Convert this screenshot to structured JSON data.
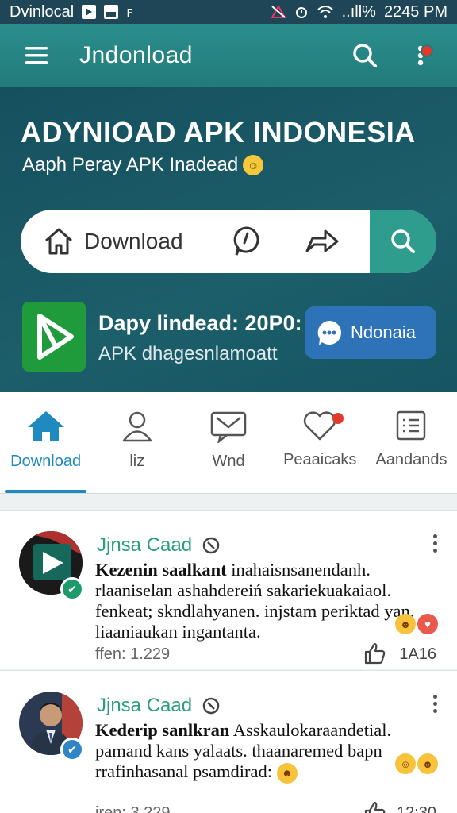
{
  "status_bar": {
    "carrier": "Dvinlocal",
    "time": "2245 PM",
    "signal": "..ıll%"
  },
  "app_bar": {
    "title": "Jndonload"
  },
  "hero": {
    "title": "ADYNIOAD APK INDONESIA",
    "subtitle": "Aaph Peray APK Inadead",
    "search": {
      "label": "Download"
    },
    "promo": {
      "title": "Dapy lindead: 20P0:",
      "subtitle": "APK dhagesnlamoatt",
      "button_label": "Ndonaia"
    }
  },
  "tabs": [
    {
      "label": "Download",
      "icon": "home-icon",
      "active": true
    },
    {
      "label": "liz",
      "icon": "person-icon",
      "active": false
    },
    {
      "label": "Wnd",
      "icon": "chat-icon",
      "active": false
    },
    {
      "label": "Peaaicaks",
      "icon": "heart-icon",
      "active": false
    },
    {
      "label": "Aandands",
      "icon": "list-icon",
      "active": false
    }
  ],
  "feed": [
    {
      "name": "Jjnsa Caad",
      "text_bold": "Kezenin saalkant",
      "text": " inahaisnsanendanh. rlaaniselan ashahdereiń sakariekuakaiaol. fenkeat; skndlahyanen. injstam periktad yan. liaaniaukan ingantanta.",
      "views": "ffen: 1.229",
      "time": "1A16"
    },
    {
      "name": "Jjnsa Caad",
      "text_bold": "Kederip sanlkran",
      "text": " Asskaulokaraandetial. pamand kans yalaats. thaanaremed bapn rrafinhasanal psamdirad:",
      "views": "jren: 3.229",
      "time": "12:30"
    }
  ],
  "colors": {
    "app_bar": "#227b7a",
    "hero_bg": "#1c5e6a",
    "accent": "#1e8ac0",
    "promo_button": "#2e72b8",
    "name_green": "#2a9f7c"
  }
}
